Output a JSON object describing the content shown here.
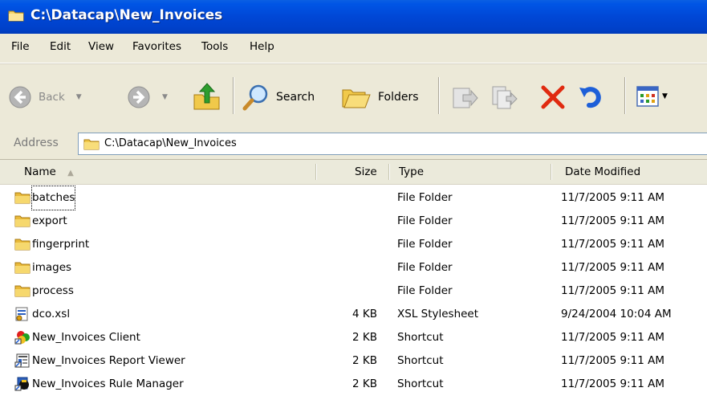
{
  "window": {
    "title": "C:\\Datacap\\New_Invoices"
  },
  "menu": [
    "File",
    "Edit",
    "View",
    "Favorites",
    "Tools",
    "Help"
  ],
  "toolbar": {
    "back_label": "Back",
    "search_label": "Search",
    "folders_label": "Folders"
  },
  "address": {
    "label": "Address",
    "value": "C:\\Datacap\\New_Invoices"
  },
  "columns": {
    "name": "Name",
    "size": "Size",
    "type": "Type",
    "date": "Date Modified"
  },
  "files": [
    {
      "name": "batches",
      "size": "",
      "type": "File Folder",
      "date": "11/7/2005 9:11 AM",
      "icon": "folder-icon"
    },
    {
      "name": "export",
      "size": "",
      "type": "File Folder",
      "date": "11/7/2005 9:11 AM",
      "icon": "folder-icon"
    },
    {
      "name": "fingerprint",
      "size": "",
      "type": "File Folder",
      "date": "11/7/2005 9:11 AM",
      "icon": "folder-icon"
    },
    {
      "name": "images",
      "size": "",
      "type": "File Folder",
      "date": "11/7/2005 9:11 AM",
      "icon": "folder-icon"
    },
    {
      "name": "process",
      "size": "",
      "type": "File Folder",
      "date": "11/7/2005 9:11 AM",
      "icon": "folder-icon"
    },
    {
      "name": "dco.xsl",
      "size": "4 KB",
      "type": "XSL Stylesheet",
      "date": "9/24/2004 10:04 AM",
      "icon": "xsl-file-icon"
    },
    {
      "name": "New_Invoices Client",
      "size": "2 KB",
      "type": "Shortcut",
      "date": "11/7/2005 9:11 AM",
      "icon": "client-shortcut-icon"
    },
    {
      "name": "New_Invoices Report Viewer",
      "size": "2 KB",
      "type": "Shortcut",
      "date": "11/7/2005 9:11 AM",
      "icon": "report-viewer-shortcut-icon"
    },
    {
      "name": "New_Invoices Rule Manager",
      "size": "2 KB",
      "type": "Shortcut",
      "date": "11/7/2005 9:11 AM",
      "icon": "rule-manager-shortcut-icon"
    }
  ]
}
